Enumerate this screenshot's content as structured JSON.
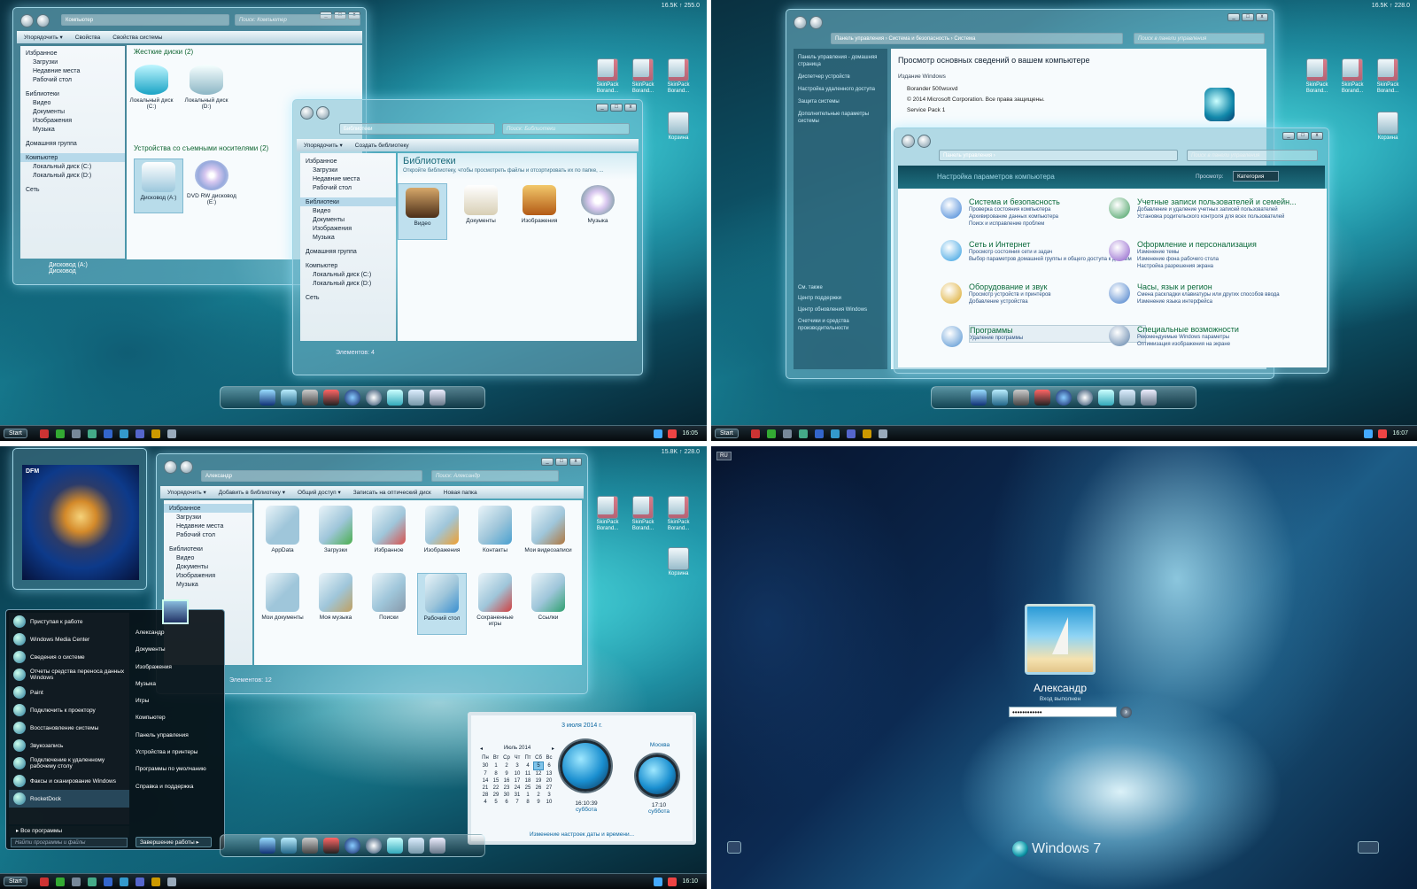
{
  "q1": {
    "top_stat": "16.5K ↑ 255.0",
    "clock": "16:05",
    "start": "Start",
    "win1": {
      "address": "Компьютер",
      "search": "Поиск: Компьютер",
      "toolbar": [
        "Упорядочить ▾",
        "Свойства",
        "Свойства системы"
      ],
      "nav": [
        {
          "h": 1,
          "t": "Избранное"
        },
        {
          "t": "Загрузки"
        },
        {
          "t": "Недавние места"
        },
        {
          "t": "Рабочий стол"
        },
        {
          "h": 1,
          "t": "Библиотеки"
        },
        {
          "t": "Видео"
        },
        {
          "t": "Документы"
        },
        {
          "t": "Изображения"
        },
        {
          "t": "Музыка"
        },
        {
          "h": 1,
          "t": "Домашняя группа"
        },
        {
          "h": 1,
          "t": "Компьютер",
          "sel": 1
        },
        {
          "t": "Локальный диск (C:)"
        },
        {
          "t": "Локальный диск (D:)"
        },
        {
          "h": 1,
          "t": "Сеть"
        }
      ],
      "sec1": "Жесткие диски (2)",
      "sec2": "Устройства со съемными носителями (2)",
      "items": [
        "Локальный диск (C:)",
        "Локальный диск (D:)",
        "Дисковод (A:)",
        "DVD RW дисковод (E:)"
      ],
      "status": [
        "Дисковод (A:)",
        "Дисковод"
      ]
    },
    "win2": {
      "address": "Библиотеки",
      "search": "Поиск: Библиотеки",
      "toolbar": [
        "Упорядочить ▾",
        "Создать библиотеку"
      ],
      "nav": [
        {
          "h": 1,
          "t": "Избранное"
        },
        {
          "t": "Загрузки"
        },
        {
          "t": "Недавние места"
        },
        {
          "t": "Рабочий стол"
        },
        {
          "h": 1,
          "t": "Библиотеки",
          "sel": 1
        },
        {
          "t": "Видео"
        },
        {
          "t": "Документы"
        },
        {
          "t": "Изображения"
        },
        {
          "t": "Музыка"
        },
        {
          "h": 1,
          "t": "Домашняя группа"
        },
        {
          "h": 1,
          "t": "Компьютер"
        },
        {
          "t": "Локальный диск (C:)"
        },
        {
          "t": "Локальный диск (D:)"
        },
        {
          "h": 1,
          "t": "Сеть"
        }
      ],
      "title": "Библиотеки",
      "subtitle": "Откройте библиотеку, чтобы просмотреть файлы и отсортировать их по папке, ...",
      "items": [
        "Видео",
        "Документы",
        "Изображения",
        "Музыка"
      ],
      "status": "Элементов: 4"
    },
    "desktop": [
      "SkinPack Borand...",
      "SkinPack Borand...",
      "SkinPack Borand...",
      "Корзина"
    ]
  },
  "q2": {
    "top_stat": "16.5K ↑ 228.0",
    "clock": "16:07",
    "start": "Start",
    "syswin": {
      "address": "Панель управления › Система и безопасность › Система",
      "search": "Поиск в панели управления",
      "side": [
        "Панель управления - домашняя страница",
        "Диспетчер устройств",
        "Настройка удаленного доступа",
        "Защита системы",
        "Дополнительные параметры системы"
      ],
      "see_also": "См. также",
      "see_items": [
        "Центр поддержки",
        "Центр обновления Windows",
        "Счетчики и средства производительности"
      ],
      "title": "Просмотр основных сведений о вашем компьютере",
      "edition_h": "Издание Windows",
      "edition": "Borander 500wsxvd",
      "copyright": "© 2014 Microsoft Corporation. Все права защищены.",
      "sp": "Service Pack 1"
    },
    "cpwin": {
      "address": "Панель управления ›",
      "search": "Поиск в панели управления",
      "header": "Настройка параметров компьютера",
      "view": "Просмотр:",
      "view_val": "Категория",
      "items": [
        {
          "t": "Система и безопасность",
          "s": [
            "Проверка состояния компьютера",
            "Архивирование данных компьютера",
            "Поиск и исправление проблем"
          ]
        },
        {
          "t": "Сеть и Интернет",
          "s": [
            "Просмотр состояния сети и задач",
            "Выбор параметров домашней группы и общего доступа к данным"
          ]
        },
        {
          "t": "Оборудование и звук",
          "s": [
            "Просмотр устройств и принтеров",
            "Добавление устройства"
          ]
        },
        {
          "t": "Программы",
          "s": [
            "Удаление программы"
          ]
        },
        {
          "t": "Учетные записи пользователей и семейн...",
          "s": [
            "Добавление и удаление учетных записей пользователей",
            "Установка родительского контроля для всех пользователей"
          ]
        },
        {
          "t": "Оформление и персонализация",
          "s": [
            "Изменение темы",
            "Изменение фона рабочего стола",
            "Настройка разрешения экрана"
          ]
        },
        {
          "t": "Часы, язык и регион",
          "s": [
            "Смена раскладки клавиатуры или других способов ввода",
            "Изменение языка интерфейса"
          ]
        },
        {
          "t": "Специальные возможности",
          "s": [
            "Рекомендуемые Windows параметры",
            "Оптимизация изображения на экране"
          ]
        }
      ]
    },
    "desktop": [
      "SkinPack Borand...",
      "SkinPack Borand...",
      "SkinPack Borand...",
      "Корзина"
    ]
  },
  "q3": {
    "top_stat": "15.8K ↑ 228.0",
    "clock": "16:10",
    "start": "Start",
    "gadget_label": "DFM",
    "explorer": {
      "address": "Александр",
      "search": "Поиск: Александр",
      "toolbar": [
        "Упорядочить ▾",
        "Добавить в библиотеку ▾",
        "Общий доступ ▾",
        "Записать на оптический диск",
        "Новая папка"
      ],
      "nav": [
        {
          "h": 1,
          "t": "Избранное",
          "sel": 1
        },
        {
          "t": "Загрузки"
        },
        {
          "t": "Недавние места"
        },
        {
          "t": "Рабочий стол"
        },
        {
          "h": 1,
          "t": "Библиотеки"
        },
        {
          "t": "Видео"
        },
        {
          "t": "Документы"
        },
        {
          "t": "Изображения"
        },
        {
          "t": "Музыка"
        }
      ],
      "items": [
        "AppData",
        "Загрузки",
        "Избранное",
        "Изображения",
        "Контакты",
        "Мои видеозаписи",
        "Мои документы",
        "Моя музыка",
        "Поиски",
        "Рабочий стол",
        "Сохраненные игры",
        "Ссылки"
      ],
      "status": "Элементов: 12"
    },
    "start_menu": {
      "left": [
        "Приступая к работе",
        "Windows Media Center",
        "Сведения о системе",
        "Отчеты средства переноса данных Windows",
        "Paint",
        "Подключить к проектору",
        "Восстановление системы",
        "Звукозапись",
        "Подключение к удаленному рабочему столу",
        "Факсы и сканирование Windows",
        "RocketDock"
      ],
      "all": "Все программы",
      "search": "Найти программы и файлы",
      "right": [
        "Александр",
        "Документы",
        "Изображения",
        "Музыка",
        "Игры",
        "Компьютер",
        "Панель управления",
        "Устройства и принтеры",
        "Программы по умолчанию",
        "Справка и поддержка"
      ],
      "shutdown": "Завершение работы ▸"
    },
    "calendar": {
      "date": "3 июля 2014 г.",
      "month": "Июль 2014",
      "days": [
        "Пн",
        "Вт",
        "Ср",
        "Чт",
        "Пт",
        "Сб",
        "Вс"
      ],
      "rows": [
        [
          "30",
          "1",
          "2",
          "3",
          "4",
          "5",
          "6"
        ],
        [
          "7",
          "8",
          "9",
          "10",
          "11",
          "12",
          "13"
        ],
        [
          "14",
          "15",
          "16",
          "17",
          "18",
          "19",
          "20"
        ],
        [
          "21",
          "22",
          "23",
          "24",
          "25",
          "26",
          "27"
        ],
        [
          "28",
          "29",
          "30",
          "31",
          "1",
          "2",
          "3"
        ],
        [
          "4",
          "5",
          "6",
          "7",
          "8",
          "9",
          "10"
        ]
      ],
      "city": "Москва",
      "t1": "16:10:39",
      "d1": "суббота",
      "t2": "17:10",
      "d2": "суббота",
      "link": "Изменение настроек даты и времени..."
    },
    "desktop": [
      "SkinPack Borand...",
      "SkinPack Borand...",
      "SkinPack Borand...",
      "Корзина"
    ]
  },
  "q4": {
    "lang": "RU",
    "user": "Александр",
    "status": "Вход выполнен",
    "password": "••••••••••••",
    "brand": "Windows 7"
  }
}
